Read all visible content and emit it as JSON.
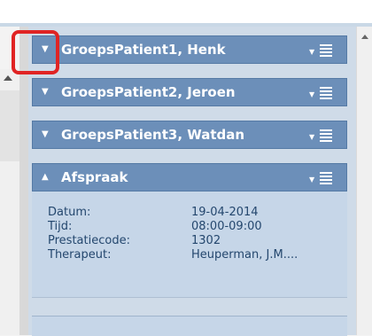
{
  "groups": [
    {
      "title": "GroepsPatient1, Henk",
      "state": "collapsed"
    },
    {
      "title": "GroepsPatient2, Jeroen",
      "state": "collapsed"
    },
    {
      "title": "GroepsPatient3, Watdan",
      "state": "collapsed"
    },
    {
      "title": "Afspraak",
      "state": "expanded"
    }
  ],
  "appointment": {
    "rows": [
      {
        "label": "Datum:",
        "value": "19-04-2014"
      },
      {
        "label": "Tijd:",
        "value": "08:00-09:00"
      },
      {
        "label": "Prestatiecode:",
        "value": "1302"
      },
      {
        "label": "Therapeut:",
        "value": "Heuperman, J.M...."
      }
    ]
  },
  "icons": {
    "collapsed_caret": "triangle-down",
    "expanded_caret": "triangle-up",
    "menu": "dropdown-hamburger"
  },
  "colors": {
    "header_bg": "#6c8fb9",
    "panel_bg": "#cfdbe8",
    "detail_text": "#24476e",
    "highlight": "#e02424"
  }
}
